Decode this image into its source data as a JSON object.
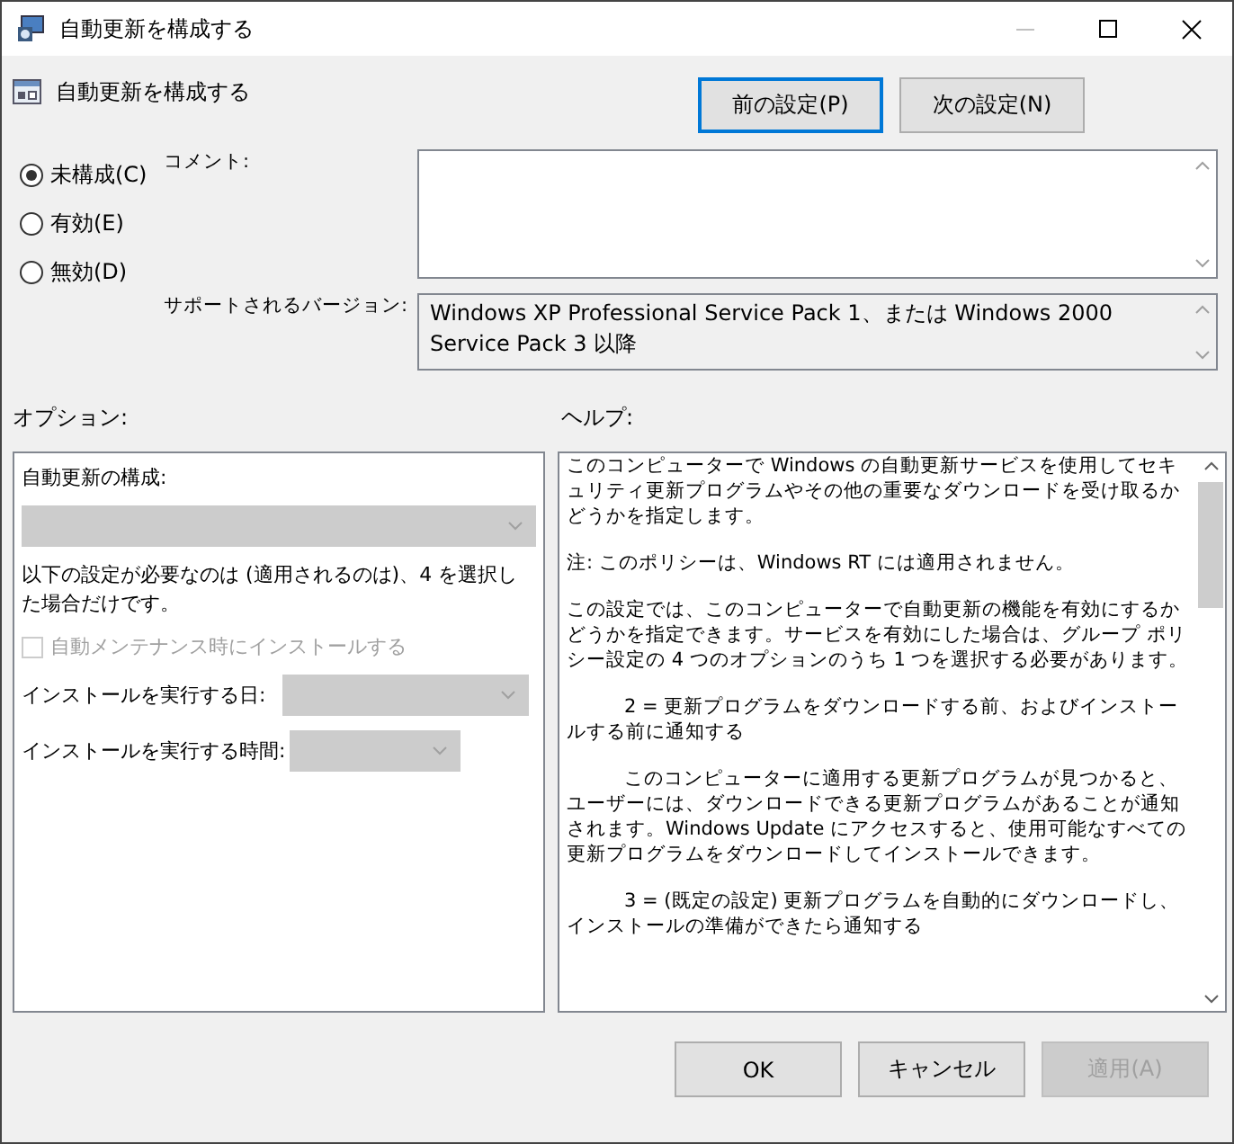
{
  "window": {
    "title": "自動更新を構成する"
  },
  "header": {
    "title": "自動更新を構成する",
    "buttons": [
      {
        "label": "前の設定(P)",
        "focused": true
      },
      {
        "label": "次の設定(N)",
        "focused": false
      }
    ]
  },
  "state_options": [
    {
      "label": "未構成(C)",
      "selected": true
    },
    {
      "label": "有効(E)",
      "selected": false
    },
    {
      "label": "無効(D)",
      "selected": false
    }
  ],
  "comment": {
    "label": "コメント:"
  },
  "supported": {
    "label": "サポートされるバージョン:",
    "value": "Windows XP Professional Service Pack 1、または Windows 2000 Service Pack 3 以降"
  },
  "options_label": "オプション:",
  "help_label": "ヘルプ:",
  "options": [
    {
      "kind": "label",
      "text": "自動更新の構成:"
    },
    {
      "kind": "dropdown",
      "disabled": true
    },
    {
      "kind": "note",
      "text": "以下の設定が必要なのは (適用されるのは)、4 を選択した場合だけです。"
    },
    {
      "kind": "checkbox",
      "text": "自動メンテナンス時にインストールする",
      "checked": false,
      "disabled": true
    },
    {
      "kind": "labeled_dropdown",
      "text": "インストールを実行する日:",
      "disabled": true,
      "wide": true
    },
    {
      "kind": "labeled_dropdown",
      "text": "インストールを実行する時間:",
      "disabled": true,
      "wide": false
    }
  ],
  "help": [
    {
      "kind": "plain",
      "text": "このコンピューターで Windows の自動更新サービスを使用してセキュリティ更新プログラムやその他の重要なダウンロードを受け取るかどうかを指定します。"
    },
    {
      "kind": "plain",
      "text": "注: このポリシーは、Windows RT には適用されません。"
    },
    {
      "kind": "plain",
      "text": "この設定では、このコンピューターで自動更新の機能を有効にするかどうかを指定できます。サービスを有効にした場合は、グループ ポリシー設定の 4 つのオプションのうち 1 つを選択する必要があります。"
    },
    {
      "kind": "indented",
      "text": "2 = 更新プログラムをダウンロードする前、およびインストールする前に通知する"
    },
    {
      "kind": "indented",
      "text": "このコンピューターに適用する更新プログラムが見つかると、ユーザーには、ダウンロードできる更新プログラムがあることが通知されます。Windows Update にアクセスすると、使用可能なすべての更新プログラムをダウンロードしてインストールできます。"
    },
    {
      "kind": "indented",
      "text": "3 = (既定の設定) 更新プログラムを自動的にダウンロードし、インストールの準備ができたら通知する"
    }
  ],
  "footer": [
    {
      "label": "OK",
      "disabled": false
    },
    {
      "label": "キャンセル",
      "disabled": false
    },
    {
      "label": "適用(A)",
      "disabled": true
    }
  ]
}
